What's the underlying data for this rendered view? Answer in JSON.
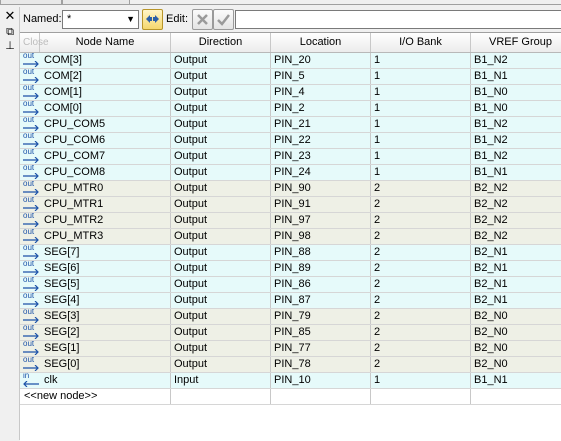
{
  "toolbar": {
    "named_label": "Named:",
    "named_value": "*",
    "edit_label": "Edit:",
    "edit_value": ""
  },
  "columns": [
    "",
    "Node Name",
    "Direction",
    "Location",
    "I/O Bank",
    "VREF Group"
  ],
  "corner_label": "Close",
  "icons": {
    "out": "out",
    "in": "in"
  },
  "rows": [
    {
      "type": "out",
      "name": "COM[3]",
      "direction": "Output",
      "location": "PIN_20",
      "bank": "1",
      "vref": "B1_N2",
      "group": "cyan"
    },
    {
      "type": "out",
      "name": "COM[2]",
      "direction": "Output",
      "location": "PIN_5",
      "bank": "1",
      "vref": "B1_N1",
      "group": "cyan"
    },
    {
      "type": "out",
      "name": "COM[1]",
      "direction": "Output",
      "location": "PIN_4",
      "bank": "1",
      "vref": "B1_N0",
      "group": "cyan"
    },
    {
      "type": "out",
      "name": "COM[0]",
      "direction": "Output",
      "location": "PIN_2",
      "bank": "1",
      "vref": "B1_N0",
      "group": "cyan"
    },
    {
      "type": "out",
      "name": "CPU_COM5",
      "direction": "Output",
      "location": "PIN_21",
      "bank": "1",
      "vref": "B1_N2",
      "group": "cyan"
    },
    {
      "type": "out",
      "name": "CPU_COM6",
      "direction": "Output",
      "location": "PIN_22",
      "bank": "1",
      "vref": "B1_N2",
      "group": "cyan"
    },
    {
      "type": "out",
      "name": "CPU_COM7",
      "direction": "Output",
      "location": "PIN_23",
      "bank": "1",
      "vref": "B1_N2",
      "group": "cyan"
    },
    {
      "type": "out",
      "name": "CPU_COM8",
      "direction": "Output",
      "location": "PIN_24",
      "bank": "1",
      "vref": "B1_N1",
      "group": "cyan"
    },
    {
      "type": "out",
      "name": "CPU_MTR0",
      "direction": "Output",
      "location": "PIN_90",
      "bank": "2",
      "vref": "B2_N2",
      "group": "grey"
    },
    {
      "type": "out",
      "name": "CPU_MTR1",
      "direction": "Output",
      "location": "PIN_91",
      "bank": "2",
      "vref": "B2_N2",
      "group": "grey"
    },
    {
      "type": "out",
      "name": "CPU_MTR2",
      "direction": "Output",
      "location": "PIN_97",
      "bank": "2",
      "vref": "B2_N2",
      "group": "grey"
    },
    {
      "type": "out",
      "name": "CPU_MTR3",
      "direction": "Output",
      "location": "PIN_98",
      "bank": "2",
      "vref": "B2_N2",
      "group": "grey"
    },
    {
      "type": "out",
      "name": "SEG[7]",
      "direction": "Output",
      "location": "PIN_88",
      "bank": "2",
      "vref": "B2_N1",
      "group": "cyan"
    },
    {
      "type": "out",
      "name": "SEG[6]",
      "direction": "Output",
      "location": "PIN_89",
      "bank": "2",
      "vref": "B2_N1",
      "group": "cyan"
    },
    {
      "type": "out",
      "name": "SEG[5]",
      "direction": "Output",
      "location": "PIN_86",
      "bank": "2",
      "vref": "B2_N1",
      "group": "cyan"
    },
    {
      "type": "out",
      "name": "SEG[4]",
      "direction": "Output",
      "location": "PIN_87",
      "bank": "2",
      "vref": "B2_N1",
      "group": "cyan"
    },
    {
      "type": "out",
      "name": "SEG[3]",
      "direction": "Output",
      "location": "PIN_79",
      "bank": "2",
      "vref": "B2_N0",
      "group": "grey"
    },
    {
      "type": "out",
      "name": "SEG[2]",
      "direction": "Output",
      "location": "PIN_85",
      "bank": "2",
      "vref": "B2_N0",
      "group": "grey"
    },
    {
      "type": "out",
      "name": "SEG[1]",
      "direction": "Output",
      "location": "PIN_77",
      "bank": "2",
      "vref": "B2_N0",
      "group": "grey"
    },
    {
      "type": "out",
      "name": "SEG[0]",
      "direction": "Output",
      "location": "PIN_78",
      "bank": "2",
      "vref": "B2_N0",
      "group": "grey"
    },
    {
      "type": "in",
      "name": "clk",
      "direction": "Input",
      "location": "PIN_10",
      "bank": "1",
      "vref": "B1_N1",
      "group": "cyan"
    }
  ],
  "new_node_label": "<<new node>>"
}
